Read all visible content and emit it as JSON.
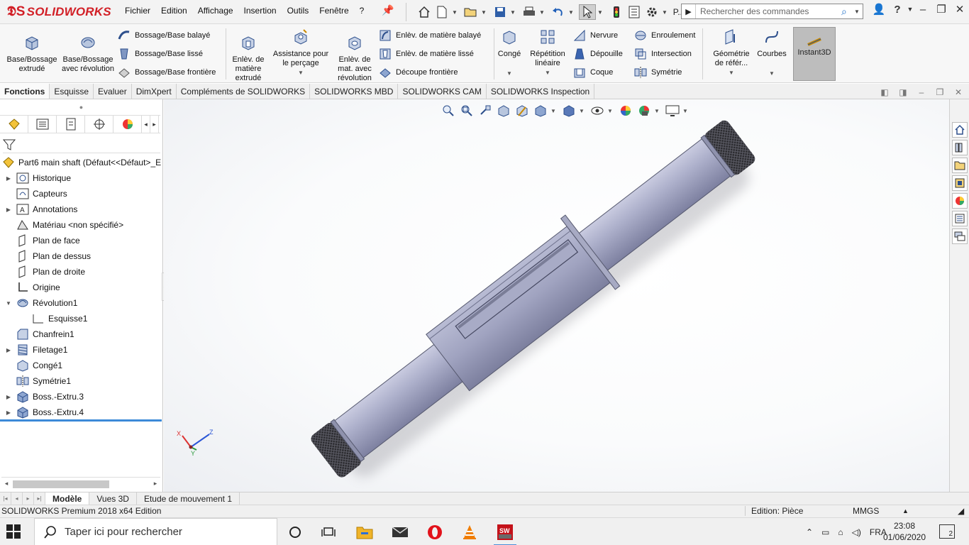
{
  "app": {
    "logo_text": "SOLIDWORKS",
    "menus": [
      "Fichier",
      "Edition",
      "Affichage",
      "Insertion",
      "Outils",
      "Fenêtre",
      "?"
    ],
    "quick_more_label": "P...",
    "search_placeholder": "Rechercher des commandes"
  },
  "ribbon": {
    "base_extrude": "Base/Bossage extrudé",
    "base_revolve": "Base/Bossage avec révolution",
    "swept_boss": "Bossage/Base balayé",
    "loft_boss": "Bossage/Base lissé",
    "boundary_boss": "Bossage/Base frontière",
    "extruded_cut": "Enlèv. de matière extrudé",
    "hole_wizard": "Assistance pour le perçage",
    "revolved_cut": "Enlèv. de mat. avec révolution",
    "swept_cut": "Enlèv. de matière balayé",
    "lofted_cut": "Enlèv. de matière lissé",
    "boundary_cut": "Découpe frontière",
    "fillet": "Congé",
    "linear_pattern": "Répétition linéaire",
    "rib": "Nervure",
    "draft": "Dépouille",
    "shell": "Coque",
    "wrap": "Enroulement",
    "intersect": "Intersection",
    "mirror": "Symétrie",
    "ref_geometry": "Géométrie de référ...",
    "curves": "Courbes",
    "instant3d": "Instant3D"
  },
  "cm_tabs": [
    "Fonctions",
    "Esquisse",
    "Evaluer",
    "DimXpert",
    "Compléments de SOLIDWORKS",
    "SOLIDWORKS MBD",
    "SOLIDWORKS CAM",
    "SOLIDWORKS Inspection"
  ],
  "tree": {
    "root": "Part6 main shaft  (Défaut<<Défaut>_E",
    "items": [
      {
        "label": "Historique",
        "expandable": true,
        "icon": "history-icon"
      },
      {
        "label": "Capteurs",
        "expandable": false,
        "icon": "sensor-icon"
      },
      {
        "label": "Annotations",
        "expandable": true,
        "icon": "annotations-icon"
      },
      {
        "label": "Matériau <non spécifié>",
        "expandable": false,
        "icon": "material-icon"
      },
      {
        "label": "Plan de face",
        "expandable": false,
        "icon": "plane-icon"
      },
      {
        "label": "Plan de dessus",
        "expandable": false,
        "icon": "plane-icon"
      },
      {
        "label": "Plan de droite",
        "expandable": false,
        "icon": "plane-icon"
      },
      {
        "label": "Origine",
        "expandable": false,
        "icon": "origin-icon"
      },
      {
        "label": "Révolution1",
        "expandable": true,
        "expanded": true,
        "icon": "revolve-icon"
      },
      {
        "label": "Esquisse1",
        "expandable": false,
        "child": true,
        "icon": "sketch-icon"
      },
      {
        "label": "Chanfrein1",
        "expandable": false,
        "icon": "chamfer-icon"
      },
      {
        "label": "Filetage1",
        "expandable": true,
        "icon": "thread-icon"
      },
      {
        "label": "Congé1",
        "expandable": false,
        "icon": "fillet-icon"
      },
      {
        "label": "Symétrie1",
        "expandable": false,
        "icon": "mirror-icon"
      },
      {
        "label": "Boss.-Extru.3",
        "expandable": true,
        "icon": "extrude-icon"
      },
      {
        "label": "Boss.-Extru.4",
        "expandable": true,
        "icon": "extrude-icon"
      }
    ]
  },
  "triad": {
    "x_label": "X",
    "y_label": "Y",
    "z_label": "Z"
  },
  "bottom_tabs": [
    "Modèle",
    "Vues 3D",
    "Etude de mouvement 1"
  ],
  "status": {
    "left": "SOLIDWORKS Premium 2018 x64 Edition",
    "mode": "Edition: Pièce",
    "units": "MMGS"
  },
  "taskbar": {
    "search_placeholder": "Taper ici pour rechercher",
    "lang": "FRA",
    "time": "23:08",
    "date": "01/06/2020",
    "notification_count": "2"
  },
  "colors": {
    "accent": "#d21f26",
    "shaft": "#9da0bd",
    "selection": "#3c8ad8"
  }
}
